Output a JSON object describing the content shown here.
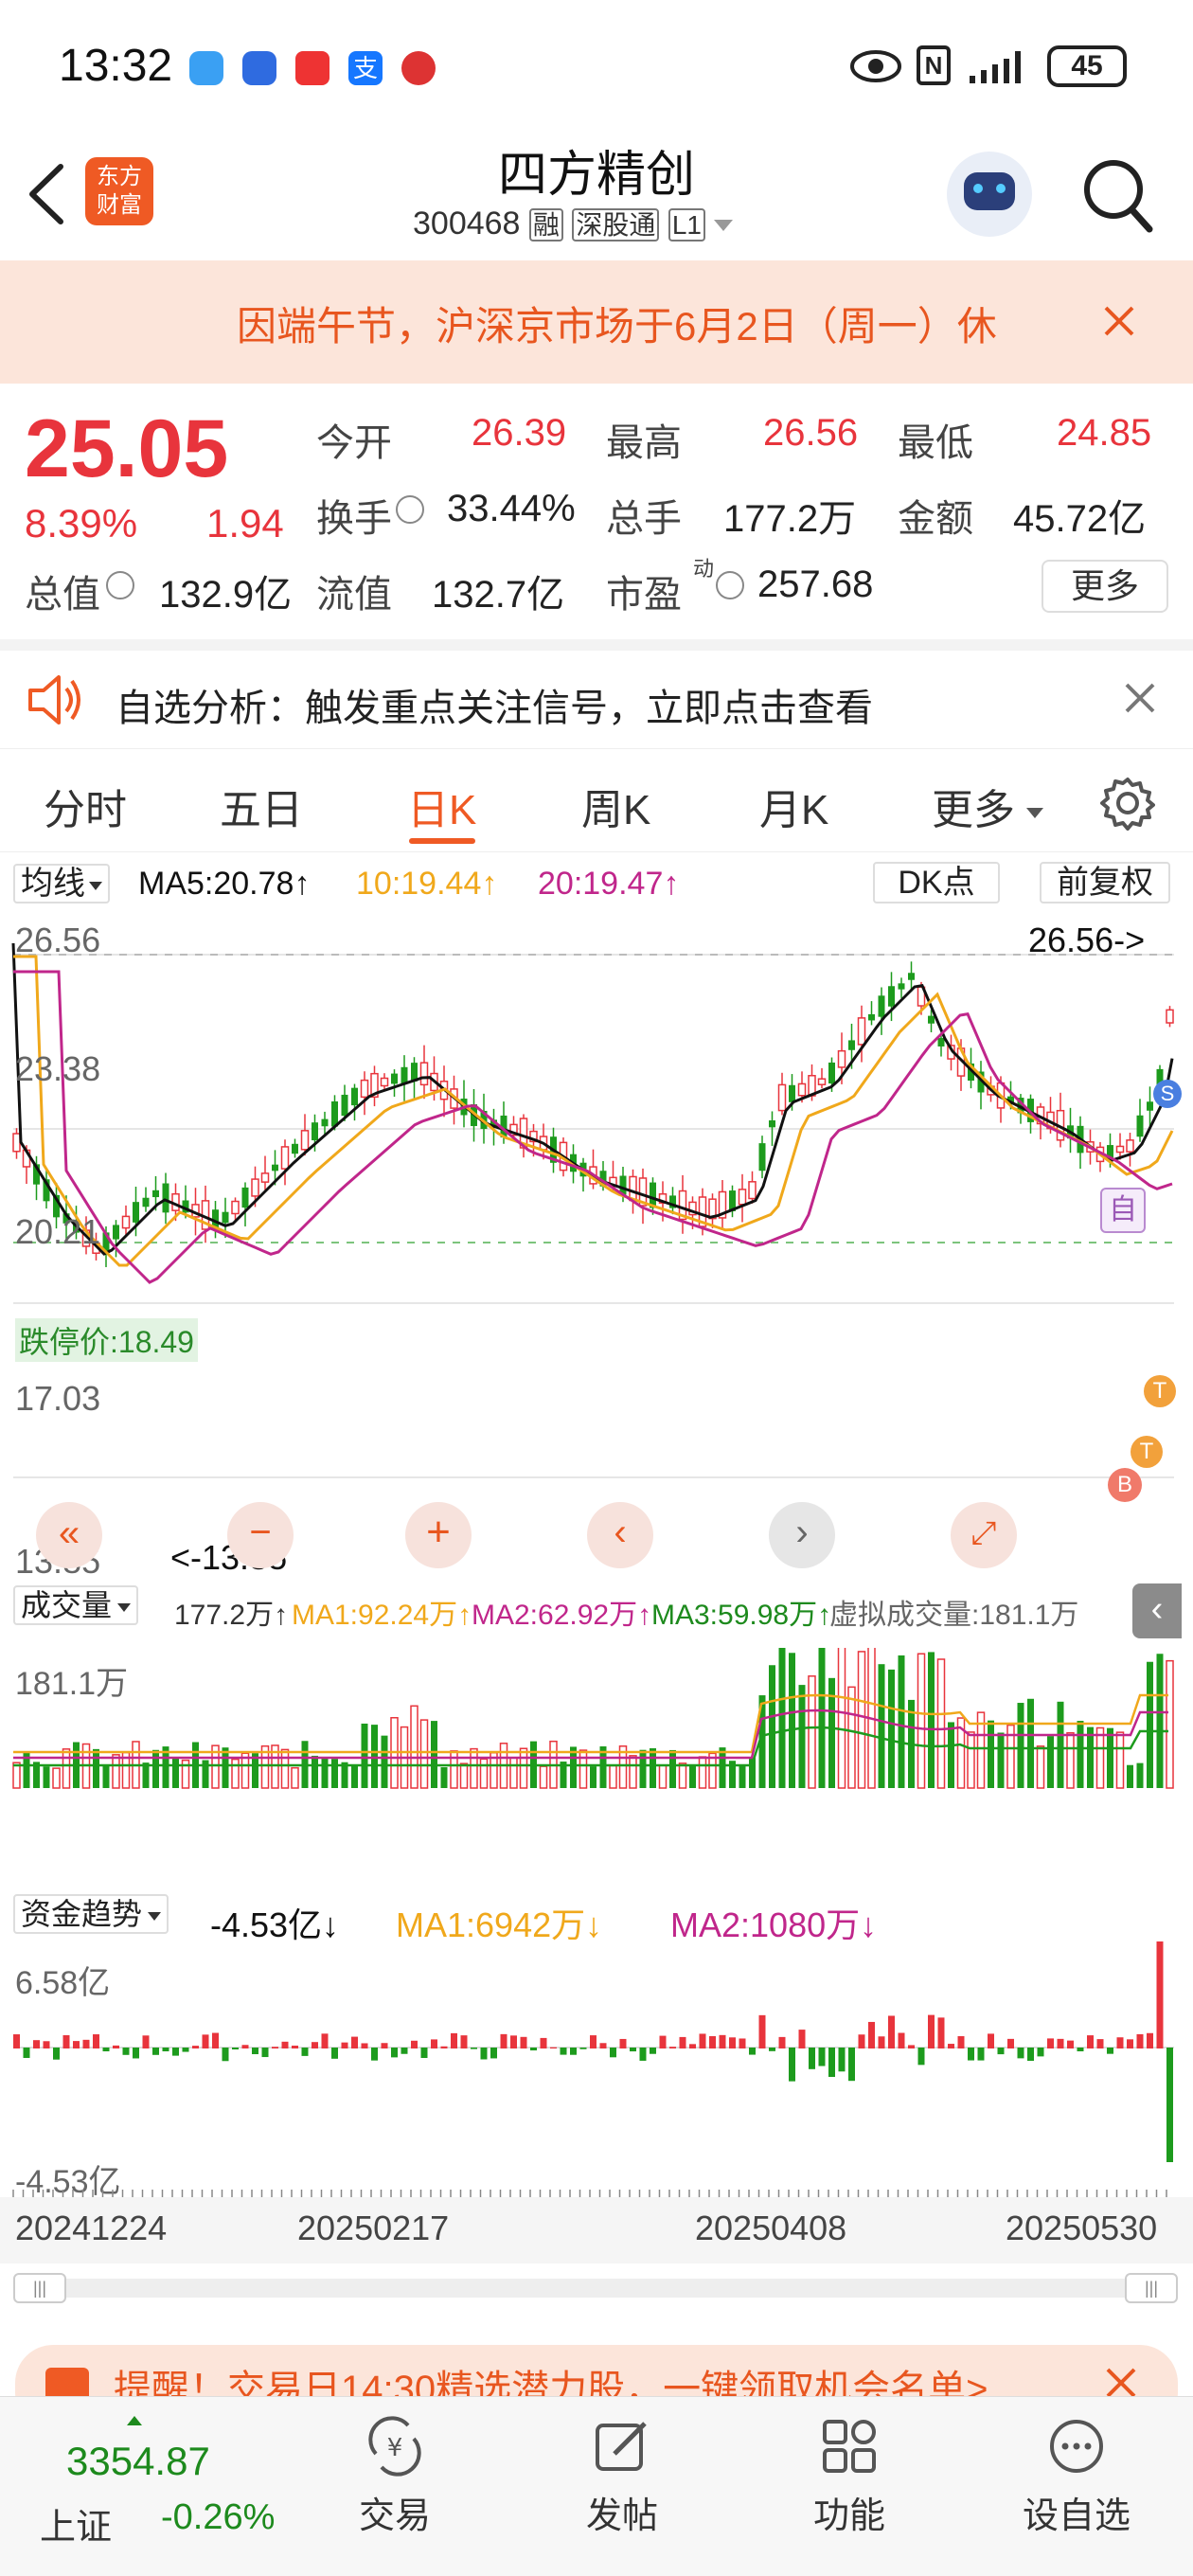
{
  "status_bar": {
    "time": "13:32",
    "battery": "45"
  },
  "header": {
    "app_logo_line1": "东方",
    "app_logo_line2": "财富",
    "title": "四方精创",
    "code": "300468",
    "tag_margin": "融",
    "tag_connect": "深股通",
    "tag_level": "L1"
  },
  "notice": {
    "text": "因端午节，沪深京市场于6月2日（周一）休"
  },
  "quote": {
    "price": "25.05",
    "change_pct": "8.39%",
    "change": "1.94",
    "fields": [
      {
        "label": "今开",
        "value": "26.39"
      },
      {
        "label": "最高",
        "value": "26.56"
      },
      {
        "label": "最低",
        "value": "24.85"
      },
      {
        "label": "换手",
        "value": "33.44%"
      },
      {
        "label": "总手",
        "value": "177.2万"
      },
      {
        "label": "金额",
        "value": "45.72亿"
      },
      {
        "label": "总值",
        "value": "132.9亿"
      },
      {
        "label": "流值",
        "value": "132.7亿"
      },
      {
        "label": "市盈",
        "value": "257.68"
      }
    ],
    "pe_superscript": "动",
    "more_label": "更多"
  },
  "analysis": {
    "text": "自选分析：触发重点关注信号，立即点击查看"
  },
  "tabs": [
    {
      "label": "分时"
    },
    {
      "label": "五日"
    },
    {
      "label": "日K"
    },
    {
      "label": "周K"
    },
    {
      "label": "月K"
    },
    {
      "label": "更多"
    }
  ],
  "kline": {
    "indicator_select": "均线",
    "ma5": "MA5:20.78↑",
    "ma10": "10:19.44↑",
    "ma20": "20:19.47↑",
    "dk_label": "DK点",
    "adjust_label": "前复权",
    "y_labels": [
      "26.56",
      "23.38",
      "20.21",
      "17.03",
      "13.85"
    ],
    "high_marker": "26.56->",
    "low_marker": "<-13.85",
    "limit_down_label": "跌停价:18.49",
    "self_tag": "自",
    "colors": {
      "up": "#e8343c",
      "down": "#1d9b1d",
      "ma5": "#111111",
      "ma10": "#f0a81b",
      "ma20": "#c0268b"
    }
  },
  "volume": {
    "select": "成交量",
    "current": "177.2万↑",
    "ma1": "MA1:92.24万↑",
    "ma2": "MA2:62.92万↑",
    "ma3": "MA3:59.98万↑",
    "virtual": "虚拟成交量:181.1万",
    "max_label": "181.1万"
  },
  "fund": {
    "select": "资金趋势",
    "current": "-4.53亿↓",
    "ma1": "MA1:6942万↓",
    "ma2": "MA2:1080万↓",
    "top_label": "6.58亿",
    "bottom_label": "-4.53亿"
  },
  "dates": [
    "20241224",
    "20250217",
    "20250408",
    "20250530"
  ],
  "promo": {
    "text": "提醒！交易日14:30精选潜力股，一键领取机会名单>"
  },
  "bottom": {
    "index_value": "3354.87",
    "index_name": "上证",
    "index_change": "-0.26%",
    "nav": [
      {
        "label": "交易"
      },
      {
        "label": "发帖"
      },
      {
        "label": "功能"
      },
      {
        "label": "设自选"
      }
    ]
  }
}
